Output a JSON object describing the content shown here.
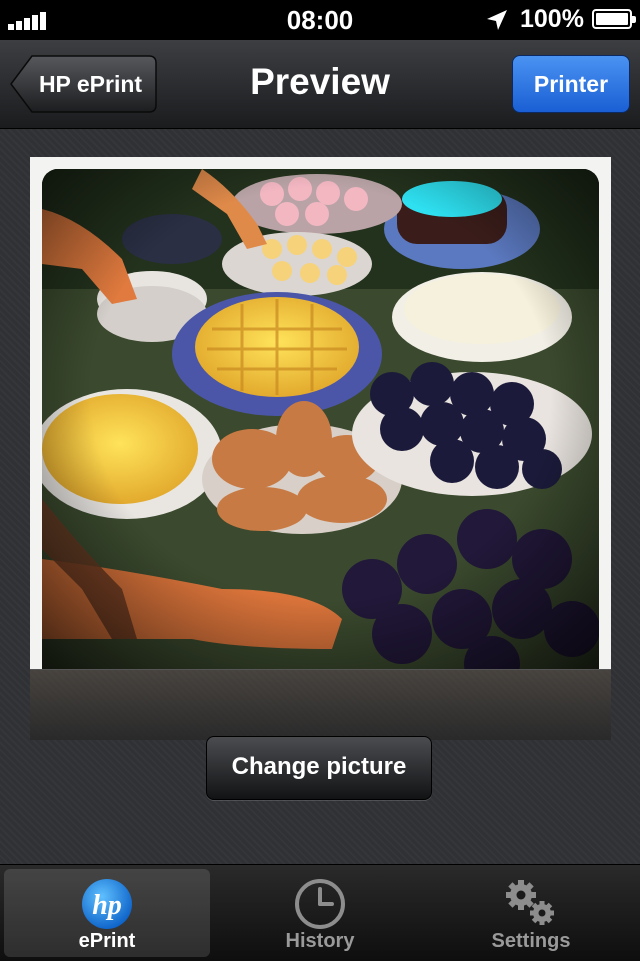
{
  "status_bar": {
    "time": "08:00",
    "battery_percent": "100%",
    "battery_level": 1.0,
    "icons": [
      "signal-icon",
      "location-arrow-icon",
      "battery-icon"
    ]
  },
  "nav": {
    "back_label": "HP ePrint",
    "title": "Preview",
    "printer_label": "Printer"
  },
  "content": {
    "change_picture_label": "Change picture"
  },
  "tabs": [
    {
      "label": "ePrint",
      "icon": "hp-logo-icon",
      "active": true
    },
    {
      "label": "History",
      "icon": "clock-icon",
      "active": false
    },
    {
      "label": "Settings",
      "icon": "gears-icon",
      "active": false
    }
  ],
  "colors": {
    "accent_blue": "#2a6fe0",
    "hp_blue": "#1e88e5"
  }
}
